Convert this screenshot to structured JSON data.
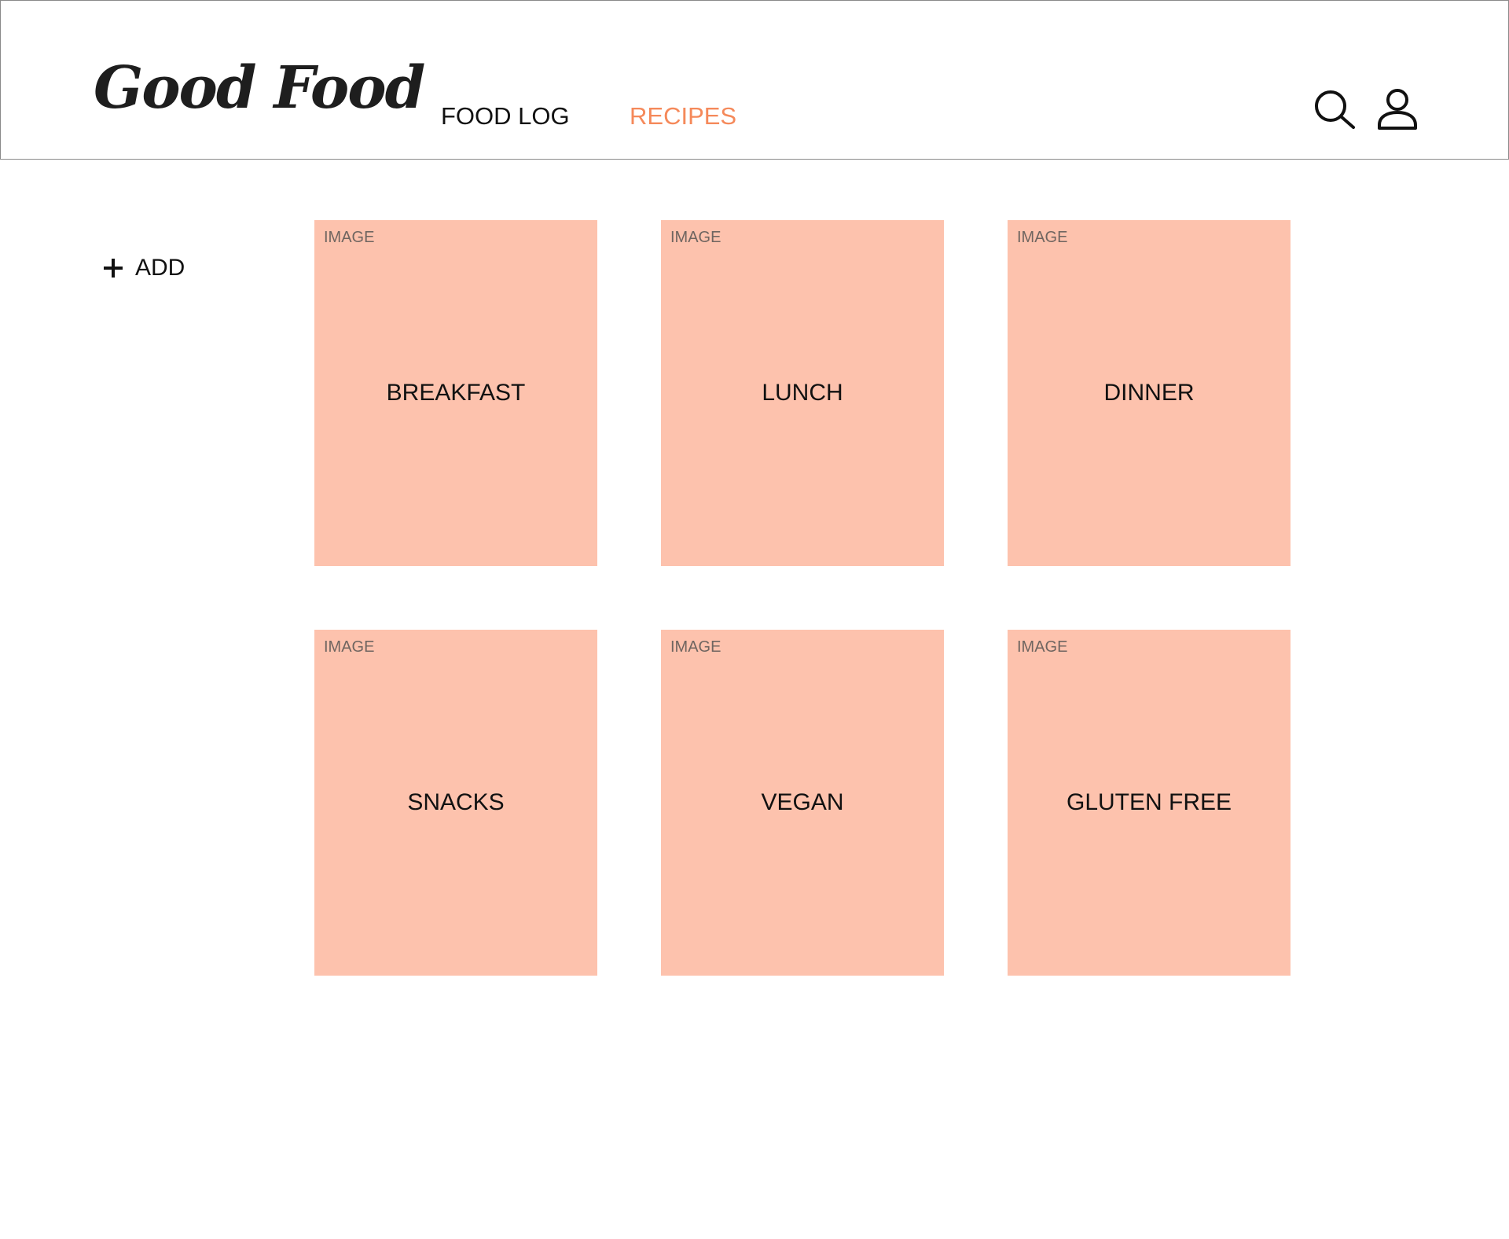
{
  "header": {
    "logo": "Good Food",
    "nav": [
      {
        "label": "FOOD LOG",
        "active": false
      },
      {
        "label": "RECIPES",
        "active": true
      }
    ],
    "icons": {
      "search": "search-icon",
      "profile": "user-icon"
    }
  },
  "sidebar": {
    "add_label": "ADD",
    "add_icon": "plus-icon"
  },
  "cards": [
    {
      "image_label": "IMAGE",
      "title": "BREAKFAST"
    },
    {
      "image_label": "IMAGE",
      "title": "LUNCH"
    },
    {
      "image_label": "IMAGE",
      "title": "DINNER"
    },
    {
      "image_label": "IMAGE",
      "title": "SNACKS"
    },
    {
      "image_label": "IMAGE",
      "title": "VEGAN"
    },
    {
      "image_label": "IMAGE",
      "title": "GLUTEN FREE"
    }
  ],
  "colors": {
    "accent": "#f5895a",
    "card_bg": "#fdc2ad",
    "text": "#111111",
    "header_border": "#8a8a8a"
  }
}
